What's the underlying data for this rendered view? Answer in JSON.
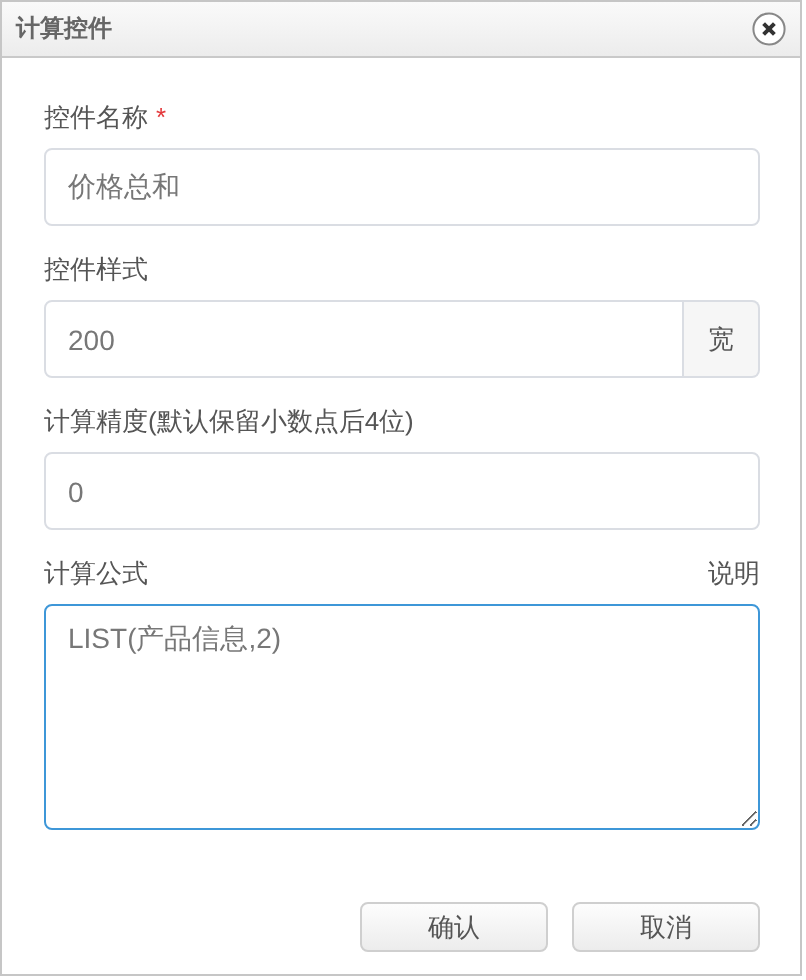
{
  "dialog": {
    "title": "计算控件"
  },
  "required_mark": "*",
  "fields": [
    {
      "kind": "text",
      "label": "控件名称",
      "required": true,
      "value": "价格总和",
      "focused": false
    },
    {
      "kind": "addon",
      "label": "控件样式",
      "required": false,
      "value": "200",
      "addon": "宽",
      "focused": false
    },
    {
      "kind": "text",
      "label": "计算精度(默认保留小数点后4位)",
      "required": false,
      "value": "0",
      "focused": false
    },
    {
      "kind": "textarea",
      "label": "计算公式",
      "required": false,
      "link": "说明",
      "value": "LIST(产品信息,2)",
      "focused": true
    }
  ],
  "buttons": [
    "确认",
    "取消"
  ]
}
